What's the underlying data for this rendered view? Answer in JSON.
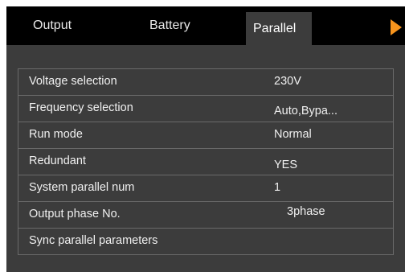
{
  "tabs": {
    "output": "Output",
    "battery": "Battery",
    "parallel": "Parallel"
  },
  "colors": {
    "accent": "#f7941d",
    "tabbar": "#000000",
    "panel": "#3c3c3c",
    "grid": "#6a6a6a"
  },
  "settings": {
    "voltage": {
      "label": "Voltage selection",
      "value": "230V"
    },
    "frequency": {
      "label": "Frequency selection",
      "value": "Auto,Bypa..."
    },
    "run_mode": {
      "label": "Run mode",
      "value": "Normal"
    },
    "redundant": {
      "label": "Redundant",
      "value": "YES"
    },
    "system_parallel_num": {
      "label": "System parallel num",
      "value": "1"
    },
    "output_phase": {
      "label": "Output phase No.",
      "value": "3phase"
    },
    "sync": {
      "label": "Sync parallel parameters"
    }
  }
}
